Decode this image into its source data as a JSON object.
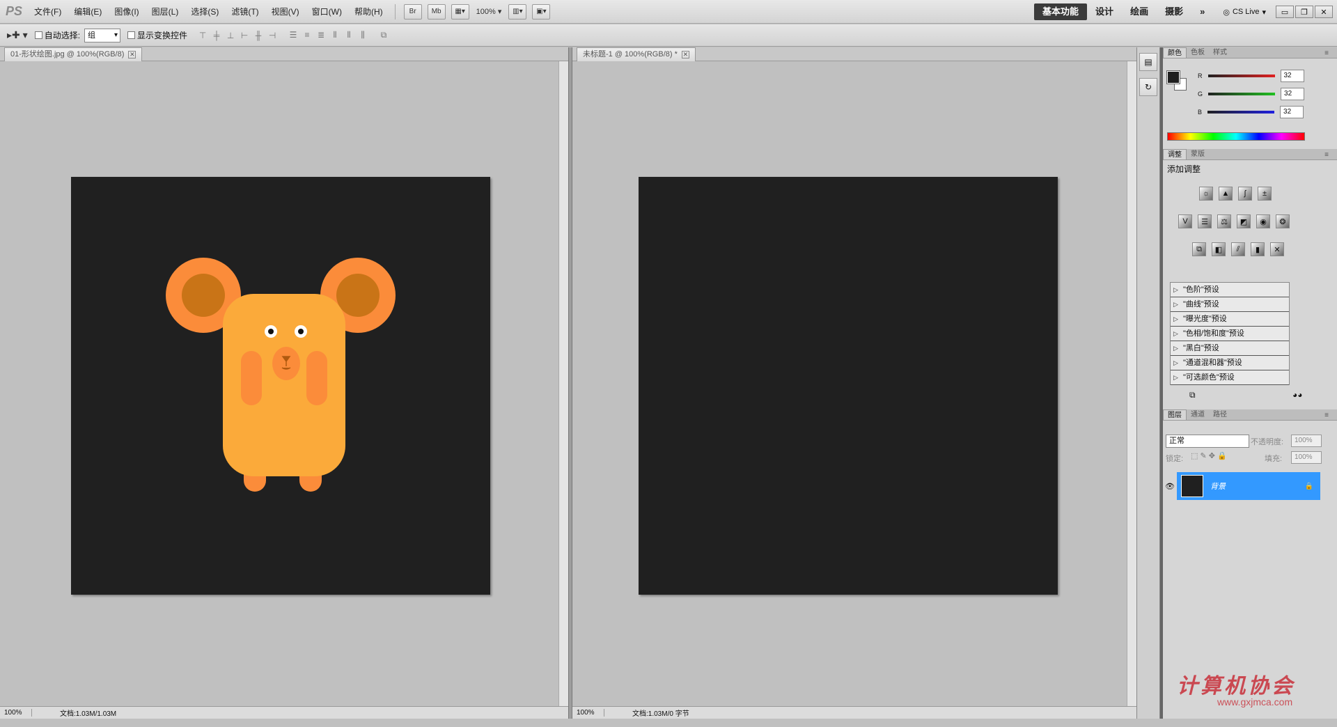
{
  "app": {
    "logo": "PS"
  },
  "menu": [
    "文件(F)",
    "编辑(E)",
    "图像(I)",
    "图层(L)",
    "选择(S)",
    "滤镜(T)",
    "视图(V)",
    "窗口(W)",
    "帮助(H)"
  ],
  "menubar_tools": {
    "br": "Br",
    "mb": "Mb",
    "zoom": "100%"
  },
  "workspaces": [
    {
      "label": "基本功能",
      "active": true
    },
    {
      "label": "设计",
      "active": false
    },
    {
      "label": "绘画",
      "active": false
    },
    {
      "label": "摄影",
      "active": false
    },
    {
      "label": "»",
      "active": false
    }
  ],
  "cs_live": "CS Live",
  "options": {
    "auto_select_label": "自动选择:",
    "auto_select_value": "组",
    "show_transform_label": "显示变换控件"
  },
  "doc1": {
    "tab": "01-形状绘图.jpg @ 100%(RGB/8)",
    "zoom": "100%",
    "info": "文档:1.03M/1.03M"
  },
  "doc2": {
    "tab": "未标题-1 @ 100%(RGB/8) *",
    "zoom": "100%",
    "info": "文档:1.03M/0 字节"
  },
  "color_panel": {
    "tabs": [
      "颜色",
      "色板",
      "样式"
    ],
    "channels": [
      {
        "name": "R",
        "value": "32",
        "color": "#e02020"
      },
      {
        "name": "G",
        "value": "32",
        "color": "#20c020"
      },
      {
        "name": "B",
        "value": "32",
        "color": "#2020e0"
      }
    ]
  },
  "adjust_panel": {
    "tabs": [
      "调整",
      "蒙版"
    ],
    "title": "添加调整",
    "presets": [
      "\"色阶\"预设",
      "\"曲线\"预设",
      "\"曝光度\"预设",
      "\"色相/饱和度\"预设",
      "\"黑白\"预设",
      "\"通道混和器\"预设",
      "\"可选颜色\"预设"
    ]
  },
  "layers_panel": {
    "tabs": [
      "图层",
      "通道",
      "路径"
    ],
    "blend_mode": "正常",
    "opacity_label": "不透明度:",
    "opacity": "100%",
    "lock_label": "锁定:",
    "fill_label": "填充:",
    "fill": "100%",
    "layer_name": "背景"
  },
  "watermark": {
    "title": "计算机协会",
    "url": "www.gxjmca.com"
  },
  "colors": {
    "canvas": "#202020",
    "ear_outer": "#fb8c3a",
    "ear_inner": "#c97417",
    "body": "#fbaa3a",
    "accent": "#fb8c3a",
    "selected_layer": "#3399ff"
  }
}
